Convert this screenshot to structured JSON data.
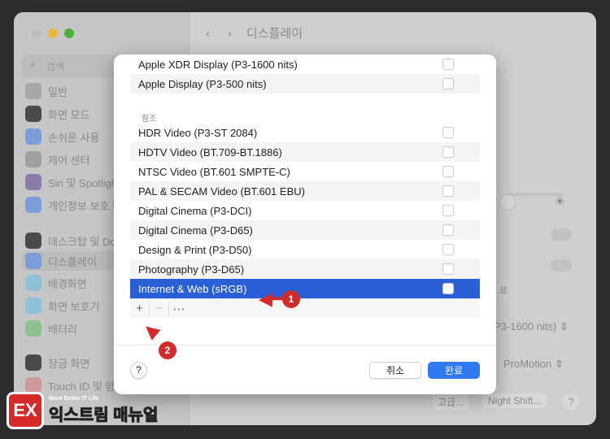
{
  "window": {
    "title": "디스플레이",
    "search_placeholder": "검색"
  },
  "sidebar": {
    "items": [
      {
        "label": "일반",
        "color": "#a8a8a8"
      },
      {
        "label": "화면 모드",
        "color": "#4a4a4a"
      },
      {
        "label": "손쉬운 사용",
        "color": "#7b9ed8"
      },
      {
        "label": "제어 센터",
        "color": "#a0a0a0"
      },
      {
        "label": "Siri 및 Spotlight",
        "color": "#8a7aa8"
      },
      {
        "label": "개인정보 보호 및 보안",
        "color": "#7b9ed8"
      },
      {
        "label": "데스크탑 및 Dock",
        "color": "#4a4a4a"
      },
      {
        "label": "디스플레이",
        "color": "#7b9ed8"
      },
      {
        "label": "배경화면",
        "color": "#8fc0d8"
      },
      {
        "label": "화면 보호기",
        "color": "#8fc0d8"
      },
      {
        "label": "배터리",
        "color": "#8fc08f"
      },
      {
        "label": "잠금 화면",
        "color": "#4a4a4a"
      },
      {
        "label": "Touch ID 및 암호",
        "color": "#d09a9a"
      }
    ]
  },
  "main": {
    "preset_value": "P3-1600 nits)",
    "refresh_value": "ProMotion",
    "partial_text": "로",
    "advanced_button": "고급...",
    "night_shift_button": "Night Shift...",
    "help": "?"
  },
  "sheet": {
    "top_rows": [
      {
        "label": "Apple XDR Display (P3-1600 nits)"
      },
      {
        "label": "Apple Display (P3-500 nits)"
      }
    ],
    "section_label": "참조",
    "rows": [
      {
        "label": "HDR Video (P3-ST 2084)"
      },
      {
        "label": "HDTV Video (BT.709-BT.1886)"
      },
      {
        "label": "NTSC Video (BT.601 SMPTE-C)"
      },
      {
        "label": "PAL & SECAM Video (BT.601 EBU)"
      },
      {
        "label": "Digital Cinema (P3-DCI)"
      },
      {
        "label": "Digital Cinema (P3-D65)"
      },
      {
        "label": "Design & Print (P3-D50)"
      },
      {
        "label": "Photography (P3-D65)"
      },
      {
        "label": "Internet & Web (sRGB)",
        "selected": true
      }
    ],
    "toolbar": {
      "add": "+",
      "remove": "−",
      "more": "⋯"
    },
    "help": "?",
    "cancel": "취소",
    "done": "완료",
    "accent": "#2a5fd6"
  },
  "annotations": {
    "step1": "1",
    "step2": "2"
  },
  "watermark": {
    "logo": "EX",
    "tagline": "More Better IT Life",
    "name": "익스트림 매뉴얼"
  }
}
